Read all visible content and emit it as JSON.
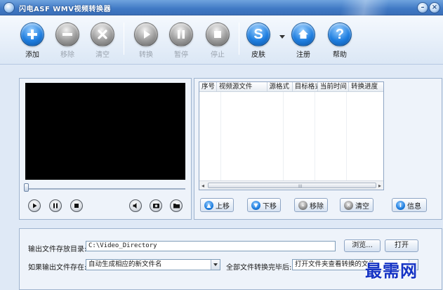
{
  "window": {
    "title": "闪电ASF WMV视频转换器",
    "icon": "app-logo-icon"
  },
  "toolbar": {
    "buttons": [
      {
        "id": "add",
        "label": "添加",
        "icon": "plus-icon",
        "enabled": true,
        "color": "#1e7ee0"
      },
      {
        "id": "remove",
        "label": "移除",
        "icon": "minus-icon",
        "enabled": false,
        "color": "#9a9a9a"
      },
      {
        "id": "clear",
        "label": "清空",
        "icon": "x-icon",
        "enabled": false,
        "color": "#9a9a9a"
      },
      {
        "id": "convert",
        "label": "转换",
        "icon": "play-icon",
        "enabled": false,
        "color": "#9a9a9a"
      },
      {
        "id": "pause",
        "label": "暂停",
        "icon": "pause-icon",
        "enabled": false,
        "color": "#9a9a9a"
      },
      {
        "id": "stop",
        "label": "停止",
        "icon": "stop-icon",
        "enabled": false,
        "color": "#9a9a9a"
      },
      {
        "id": "skin",
        "label": "皮肤",
        "icon": "skin-s-icon",
        "enabled": true,
        "color": "#1e7ee0"
      },
      {
        "id": "register",
        "label": "注册",
        "icon": "home-icon",
        "enabled": true,
        "color": "#1e7ee0"
      },
      {
        "id": "help",
        "label": "帮助",
        "icon": "question-icon",
        "enabled": true,
        "color": "#1e7ee0"
      }
    ]
  },
  "player": {
    "controls": [
      "play-icon",
      "pause-icon",
      "stop-icon",
      "volume-icon",
      "snapshot-icon",
      "folder-icon"
    ]
  },
  "file_list": {
    "columns": [
      "序号",
      "视频源文件",
      "源格式",
      "目标格式",
      "当前时间",
      "转换进度"
    ],
    "rows": [],
    "scroll_grip": "III"
  },
  "list_actions": [
    {
      "id": "move-up",
      "label": "上移",
      "icon": "arrow-up-icon"
    },
    {
      "id": "move-down",
      "label": "下移",
      "icon": "arrow-down-icon"
    },
    {
      "id": "move-out",
      "label": "移除",
      "icon": "minus-icon"
    },
    {
      "id": "clear-list",
      "label": "清空",
      "icon": "x-icon"
    },
    {
      "id": "info",
      "label": "信息",
      "icon": "info-icon"
    }
  ],
  "output": {
    "dir_label": "输出文件存放目录:",
    "dir_value": "C:\\Video_Directory",
    "browse_label": "浏览...",
    "open_label": "打开",
    "exists_label": "如果输出文件存在:",
    "exists_value": "自动生成相应的新文件名",
    "after_label": "全部文件转换完毕后:",
    "after_value": "打开文件夹查看转换的文件"
  },
  "watermark": "最需网",
  "colors": {
    "accent": "#1e7ee0",
    "titlebar": "#3f78c4",
    "background": "#dfe9f6",
    "disabled": "#9a9a9a"
  }
}
